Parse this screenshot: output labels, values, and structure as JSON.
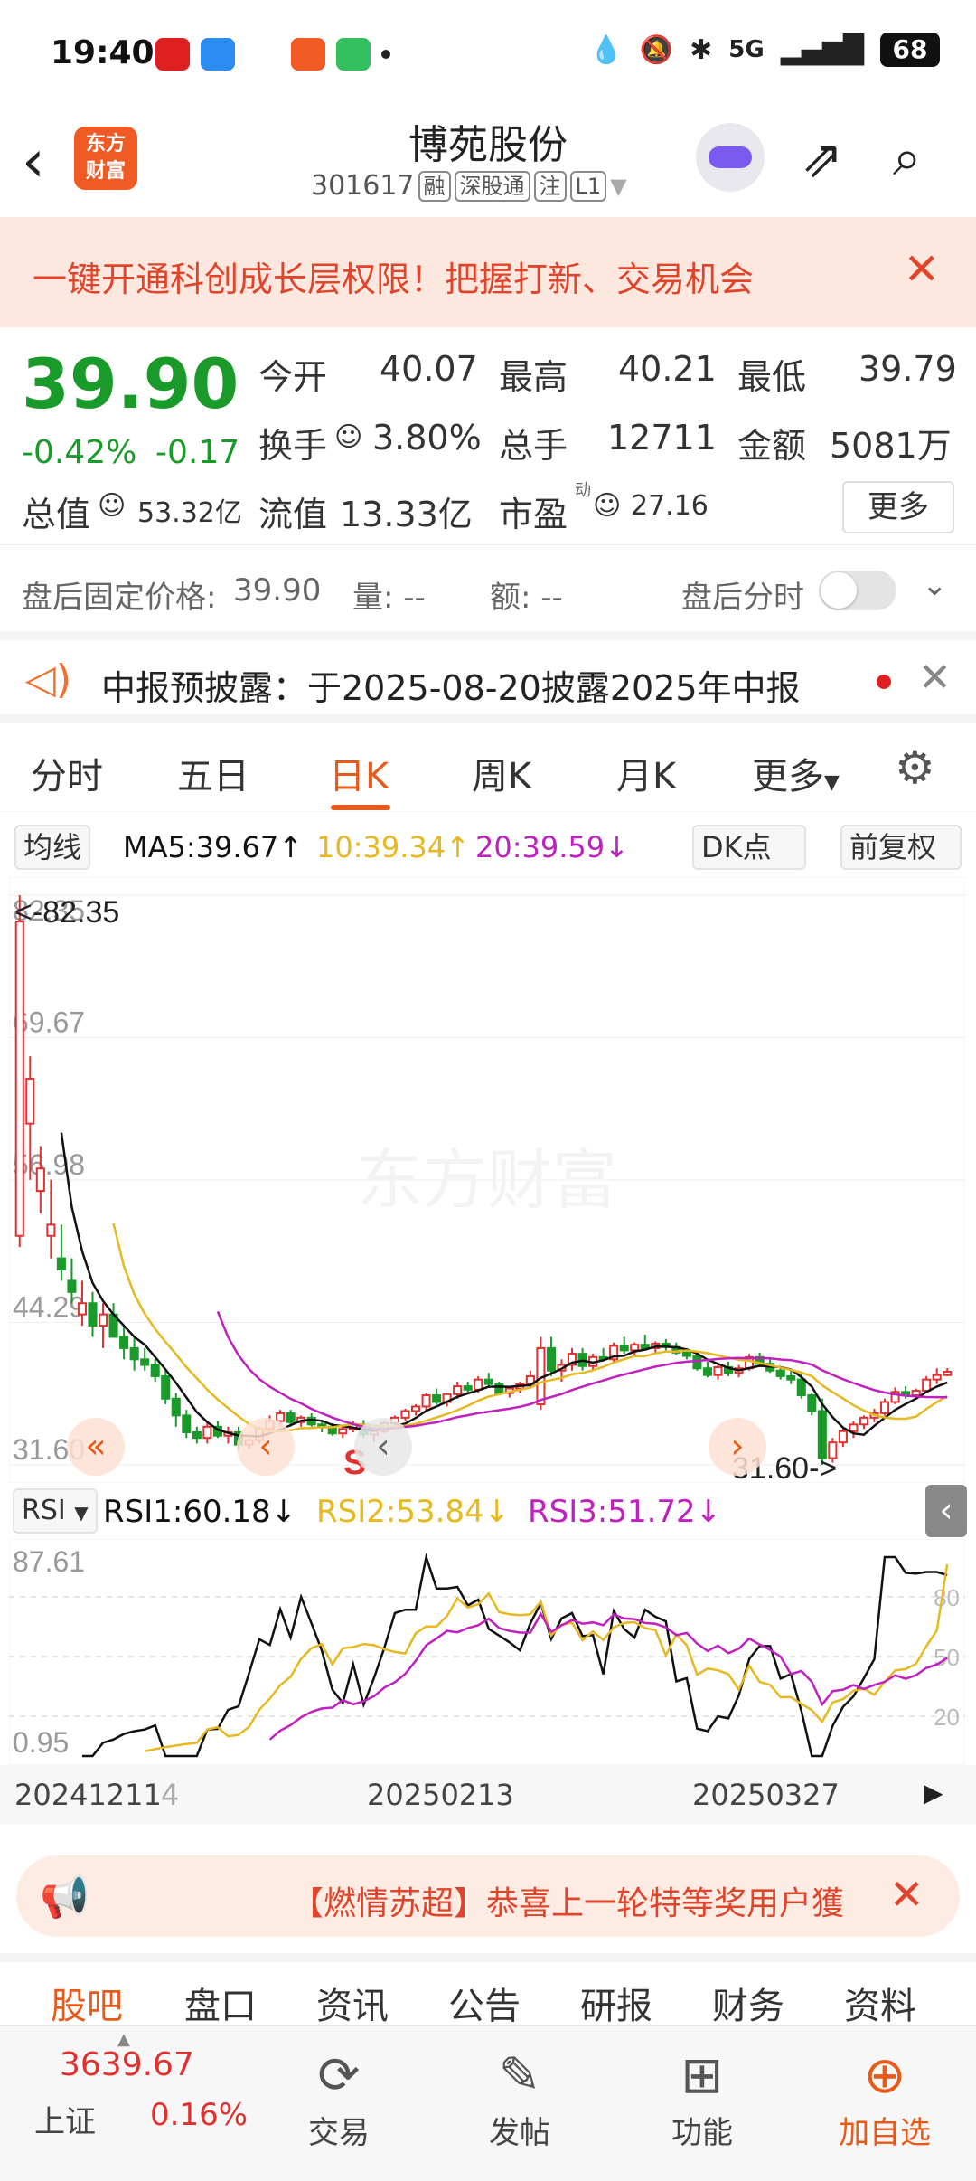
{
  "status_bar": {
    "time": "19:40",
    "battery": "68",
    "network": "5G"
  },
  "header": {
    "logo_text": "东方\n财富",
    "stock_name": "博苑股份",
    "code": "301617",
    "tags": [
      "融",
      "深股通",
      "注",
      "L1"
    ]
  },
  "banner": {
    "text": "一键开通科创成长层权限！把握打新、交易机会"
  },
  "quote": {
    "price": "39.90",
    "change_pct": "-0.42%",
    "change": "-0.17",
    "open_label": "今开",
    "open": "40.07",
    "high_label": "最高",
    "high": "40.21",
    "low_label": "最低",
    "low": "39.79",
    "turnover_label": "换手",
    "turnover": "3.80%",
    "volume_label": "总手",
    "volume": "12711",
    "amount_label": "金额",
    "amount": "5081万",
    "mcap_label": "总值",
    "mcap": "53.32亿",
    "float_label": "流值",
    "float": "13.33亿",
    "pe_label": "市盈",
    "pe_sup": "动",
    "pe": "27.16",
    "more": "更多"
  },
  "after_hours": {
    "fixed_label": "盘后固定价格:",
    "fixed_price": "39.90",
    "vol_label": "量: --",
    "amt_label": "额: --",
    "timeshare_label": "盘后分时",
    "timeshare_on": false
  },
  "notice": {
    "text": "中报预披露：于2025-08-20披露2025年中报"
  },
  "kline_tabs": [
    "分时",
    "五日",
    "日K",
    "周K",
    "月K",
    "更多"
  ],
  "kline_active": "日K",
  "ma_bar": {
    "indicator": "均线",
    "ma5": "MA5:39.67↑",
    "ma10": "10:39.34↑",
    "ma20": "20:39.59↓",
    "dk": "DK点",
    "adjust": "前复权",
    "colors": {
      "ma5": "#111111",
      "ma10": "#e8b820",
      "ma20": "#c020c0",
      "up": "#e03030",
      "down": "#1a9a2a"
    }
  },
  "chart_data": {
    "type": "candlestick",
    "y_axis_labels": [
      "82.35",
      "69.67",
      "56.98",
      "44.29",
      "31.60"
    ],
    "ylim": [
      31.6,
      82.35
    ],
    "max_marker": "<-82.35",
    "min_marker": "31.60->",
    "watermark": "东方财富",
    "signal_mark": "S",
    "x_axis_labels": [
      "20241211",
      "20250213",
      "20250327"
    ],
    "candles": [
      [
        52,
        82.35,
        51,
        80
      ],
      [
        62,
        68,
        57,
        66
      ],
      [
        56,
        60,
        54,
        58
      ],
      [
        52,
        57,
        50,
        53
      ],
      [
        50,
        53,
        48,
        49
      ],
      [
        48,
        50,
        46,
        47
      ],
      [
        45,
        48,
        44,
        46
      ],
      [
        46,
        47,
        43,
        44
      ],
      [
        44,
        46,
        42,
        45
      ],
      [
        45,
        46,
        43,
        43
      ],
      [
        43,
        44,
        41,
        42
      ],
      [
        42,
        43,
        40,
        41
      ],
      [
        41,
        42,
        40,
        40.5
      ],
      [
        40.5,
        41,
        39,
        39.5
      ],
      [
        39.5,
        40,
        37,
        37.5
      ],
      [
        37.5,
        38,
        35,
        36
      ],
      [
        36,
        36.5,
        34,
        34.5
      ],
      [
        34.5,
        35,
        33.5,
        34
      ],
      [
        34,
        35.5,
        33.5,
        35
      ],
      [
        35,
        35.5,
        34,
        34.2
      ],
      [
        34.2,
        35,
        33.5,
        34.5
      ],
      [
        34.5,
        35,
        33,
        33.4
      ],
      [
        33.4,
        34,
        33,
        33.8
      ],
      [
        33.8,
        35,
        33.5,
        34.8
      ],
      [
        34.8,
        36,
        34.5,
        35.5
      ],
      [
        35.5,
        36.5,
        35,
        36.2
      ],
      [
        36.2,
        36.5,
        35,
        35.4
      ],
      [
        35.4,
        36,
        35,
        35.8
      ],
      [
        35.8,
        36.2,
        35,
        35.2
      ],
      [
        35.2,
        35.5,
        34.5,
        35
      ],
      [
        35,
        35.3,
        34.2,
        34.4
      ],
      [
        34.4,
        35,
        34,
        34.8
      ],
      [
        34.8,
        35.5,
        34.5,
        35.2
      ],
      [
        35.2,
        35.6,
        34,
        34.3
      ],
      [
        34.3,
        34.8,
        33.6,
        34.6
      ],
      [
        34.6,
        35.5,
        34.4,
        35.3
      ],
      [
        35.3,
        36,
        35,
        35.8
      ],
      [
        35.8,
        36.6,
        35.5,
        36.4
      ],
      [
        36.4,
        37,
        36,
        36.8
      ],
      [
        36.8,
        38,
        36.5,
        37.8
      ],
      [
        37.8,
        38.4,
        37,
        37.2
      ],
      [
        37.2,
        38,
        36.8,
        37.9
      ],
      [
        37.9,
        39,
        37.5,
        38.6
      ],
      [
        38.6,
        39,
        38,
        38.3
      ],
      [
        38.3,
        39.5,
        38,
        39.2
      ],
      [
        39.2,
        39.8,
        38.5,
        38.8
      ],
      [
        38.8,
        39,
        37.8,
        38.0
      ],
      [
        38.0,
        38.6,
        37.6,
        38.4
      ],
      [
        38.4,
        39,
        38,
        38.8
      ],
      [
        38.8,
        40,
        38.5,
        39.5
      ],
      [
        37,
        43,
        36.5,
        42
      ],
      [
        42,
        43,
        39.5,
        40
      ],
      [
        40,
        41,
        39,
        40.5
      ],
      [
        40.5,
        42,
        40,
        41.5
      ],
      [
        41.5,
        42,
        40,
        40.4
      ],
      [
        40.4,
        41.5,
        40,
        41.2
      ],
      [
        41.2,
        42,
        40.8,
        41.0
      ],
      [
        41.0,
        42.5,
        40.8,
        42.2
      ],
      [
        42.2,
        43,
        41.5,
        41.8
      ],
      [
        41.8,
        42.5,
        41.2,
        42.3
      ],
      [
        42.3,
        43.2,
        42,
        42.0
      ],
      [
        42.0,
        42.6,
        41.5,
        42.4
      ],
      [
        42.4,
        42.8,
        41.8,
        42.1
      ],
      [
        42.1,
        42.5,
        41.4,
        41.6
      ],
      [
        41.6,
        42,
        41,
        41.3
      ],
      [
        41.3,
        41.6,
        40,
        40.2
      ],
      [
        40.2,
        40.8,
        39.4,
        39.6
      ],
      [
        39.6,
        40.5,
        39.2,
        40.3
      ],
      [
        40.3,
        40.8,
        39.5,
        39.8
      ],
      [
        39.8,
        40.5,
        39.4,
        40.2
      ],
      [
        40.2,
        41.5,
        40,
        41.2
      ],
      [
        41.2,
        41.6,
        40.4,
        40.6
      ],
      [
        40.6,
        41,
        39.8,
        40.0
      ],
      [
        40.0,
        40.4,
        39.2,
        39.5
      ],
      [
        39.5,
        40,
        38.8,
        39.2
      ],
      [
        39.2,
        39.8,
        37.5,
        37.8
      ],
      [
        37.8,
        38,
        36,
        36.4
      ],
      [
        36.4,
        37.5,
        31.6,
        32.2
      ],
      [
        32.2,
        34,
        31.8,
        33.6
      ],
      [
        33.6,
        35,
        33.2,
        34.6
      ],
      [
        34.6,
        35.5,
        34,
        35.2
      ],
      [
        35.2,
        36,
        34.8,
        35.8
      ],
      [
        35.8,
        36.6,
        35.4,
        36.2
      ],
      [
        36.2,
        37.5,
        36,
        37.2
      ],
      [
        37.2,
        38.5,
        37,
        38.1
      ],
      [
        38.1,
        38.6,
        37.5,
        37.8
      ],
      [
        37.8,
        38.4,
        37.4,
        38.2
      ],
      [
        38.2,
        39.5,
        38,
        39.2
      ],
      [
        39.2,
        40.2,
        38.8,
        39.6
      ],
      [
        39.6,
        40.21,
        39.5,
        39.9
      ]
    ]
  },
  "rsi_bar": {
    "indicator": "RSI",
    "rsi1": "RSI1:60.18↓",
    "rsi2": "RSI2:53.84↓",
    "rsi3": "RSI3:51.72↓"
  },
  "rsi_chart": {
    "y_labels": [
      "87.61",
      "0.95"
    ],
    "ref_levels": [
      "80",
      "50",
      "20"
    ]
  },
  "dates": {
    "d1": "20241211",
    "d1_tail": "4",
    "d2": "20250213",
    "d3": "20250327"
  },
  "promo": {
    "text": "【燃情苏超】恭喜上一轮特等奖用户獲"
  },
  "bottom_tabs": [
    "股吧",
    "盘口",
    "资讯",
    "公告",
    "研报",
    "财务",
    "资料"
  ],
  "bottom_tab_active": "股吧",
  "nav": {
    "index_value": "3639.67",
    "index_name": "上证",
    "index_change": "0.16%",
    "items": [
      "交易",
      "发帖",
      "功能",
      "加自选"
    ]
  }
}
